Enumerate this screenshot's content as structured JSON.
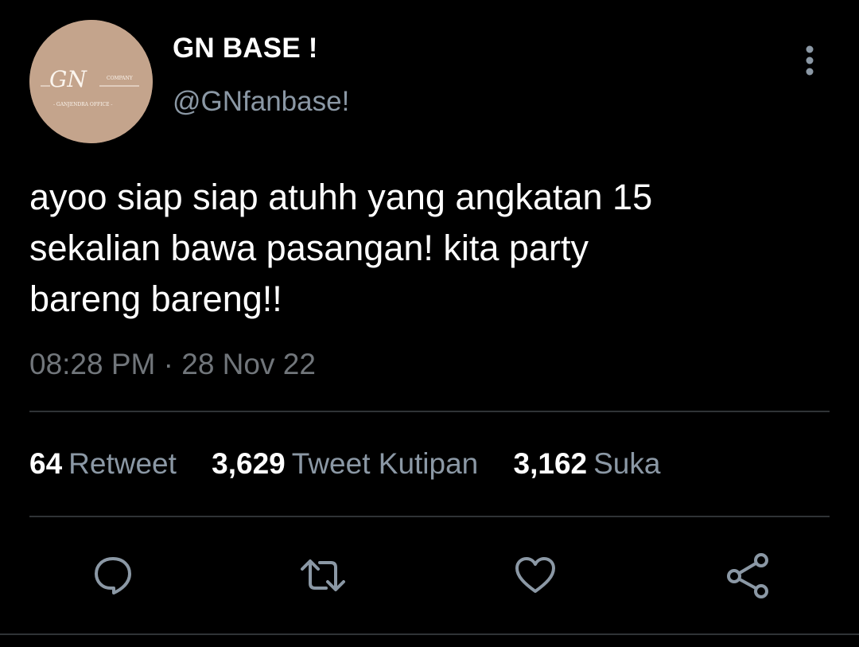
{
  "tweet": {
    "author": {
      "display_name": "GN BASE !",
      "handle": "@GNfanbase!",
      "avatar": {
        "logo_text": "GN",
        "logo_subtext": "COMPANY",
        "logo_caption": "GANJENDRA OFFICE",
        "color": "#c4a48c"
      }
    },
    "text_lines": [
      "ayoo siap siap atuhh yang angkatan 15",
      "sekalian bawa pasangan! kita party",
      "bareng bareng!!"
    ],
    "timestamp": "08:28 PM · 28 Nov 22",
    "stats": {
      "retweets": {
        "count": "64",
        "label": "Retweet"
      },
      "quotes": {
        "count": "3,629",
        "label": "Tweet Kutipan"
      },
      "likes": {
        "count": "3,162",
        "label": "Suka"
      }
    }
  },
  "actions": [
    {
      "name": "reply",
      "icon": "speech-bubble-icon"
    },
    {
      "name": "retweet",
      "icon": "retweet-arrows-icon"
    },
    {
      "name": "like",
      "icon": "heart-icon"
    },
    {
      "name": "share",
      "icon": "share-nodes-icon"
    }
  ],
  "theme": {
    "background": "#000000",
    "primary_text": "#ffffff",
    "secondary_text": "#8b98a5",
    "divider": "#2f3336",
    "icon_color": "#8b98a5"
  }
}
